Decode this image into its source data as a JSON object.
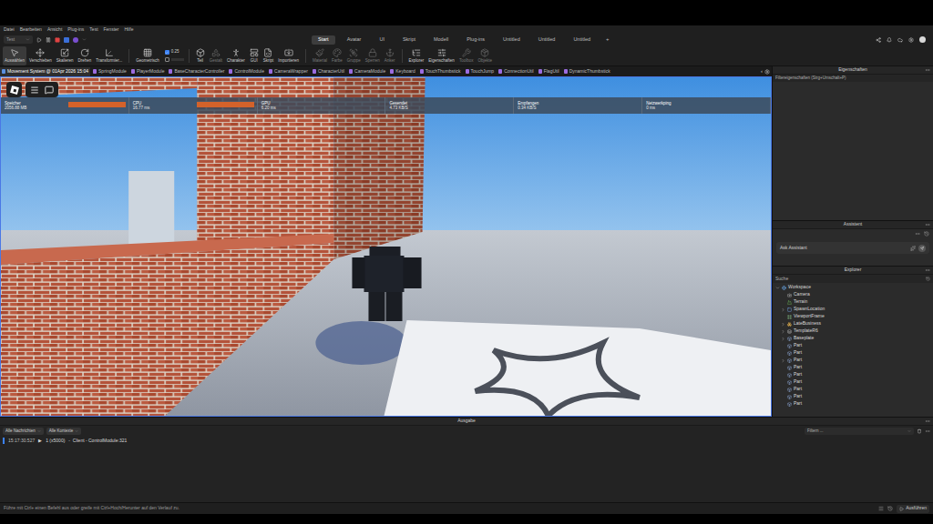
{
  "menu": [
    "Datei",
    "Bearbeiten",
    "Ansicht",
    "Plug-ins",
    "Test",
    "Fenster",
    "Hilfe"
  ],
  "mode_dropdown": "Test",
  "ribbon_tabs": [
    {
      "label": "Start",
      "selected": true
    },
    {
      "label": "Avatar",
      "selected": false
    },
    {
      "label": "UI",
      "selected": false
    },
    {
      "label": "Skript",
      "selected": false
    },
    {
      "label": "Modell",
      "selected": false
    },
    {
      "label": "Plug-ins",
      "selected": false
    },
    {
      "label": "Untitled",
      "selected": false
    },
    {
      "label": "Untitled",
      "selected": false
    },
    {
      "label": "Untitled",
      "selected": false
    }
  ],
  "ribbon_add": "+",
  "tool_groups": [
    [
      {
        "label": "Auswählen",
        "selected": true,
        "disabled": false
      },
      {
        "label": "Verschieben",
        "selected": false,
        "disabled": false
      },
      {
        "label": "Skalieren",
        "selected": false,
        "disabled": false
      },
      {
        "label": "Drehen",
        "selected": false,
        "disabled": false
      },
      {
        "label": "Transformier...",
        "selected": false,
        "disabled": false
      }
    ],
    [
      {
        "label": "Geometrisch",
        "selected": false,
        "disabled": false
      }
    ],
    [
      {
        "label": "Teil",
        "selected": false,
        "disabled": false
      },
      {
        "label": "Gestalt",
        "selected": false,
        "disabled": true
      },
      {
        "label": "Charakter",
        "selected": false,
        "disabled": false
      },
      {
        "label": "GUI",
        "selected": false,
        "disabled": false
      },
      {
        "label": "Skript",
        "selected": false,
        "disabled": false
      },
      {
        "label": "Importieren",
        "selected": false,
        "disabled": false
      }
    ],
    [
      {
        "label": "Material",
        "selected": false,
        "disabled": true
      },
      {
        "label": "Farbe",
        "selected": false,
        "disabled": true
      },
      {
        "label": "Gruppe",
        "selected": false,
        "disabled": true
      },
      {
        "label": "Sperren",
        "selected": false,
        "disabled": true
      },
      {
        "label": "Anker",
        "selected": false,
        "disabled": true
      }
    ],
    [
      {
        "label": "Explorer",
        "selected": false,
        "disabled": false
      },
      {
        "label": "Eigenschaften",
        "selected": false,
        "disabled": false
      },
      {
        "label": "Toolbox",
        "selected": false,
        "disabled": true
      },
      {
        "label": "Objekte",
        "selected": false,
        "disabled": true
      }
    ]
  ],
  "snap": {
    "value": "0.25",
    "checked": true
  },
  "doc_tabs": [
    {
      "label": "Movement System @ 01Apr 2026 15:04",
      "selected": true
    },
    {
      "label": "SpringModule",
      "selected": false
    },
    {
      "label": "PlayerModule",
      "selected": false
    },
    {
      "label": "BaseCharacterController",
      "selected": false
    },
    {
      "label": "ControlModule",
      "selected": false
    },
    {
      "label": "CameraWrapper",
      "selected": false
    },
    {
      "label": "CharacterUtil",
      "selected": false
    },
    {
      "label": "CameraModule",
      "selected": false
    },
    {
      "label": "Keyboard",
      "selected": false
    },
    {
      "label": "TouchThumbstick",
      "selected": false
    },
    {
      "label": "TouchJump",
      "selected": false
    },
    {
      "label": "ConnectionUtil",
      "selected": false
    },
    {
      "label": "FlagUtil",
      "selected": false
    },
    {
      "label": "DynamicThumbstick",
      "selected": false
    }
  ],
  "doc_tabs_overflow": "‹",
  "stats": [
    {
      "label": "Speicher",
      "value": "2056.88 MB",
      "alert": true
    },
    {
      "label": "CPU",
      "value": "16.77 ms",
      "alert": true
    },
    {
      "label": "GPU",
      "value": "6.20 ms",
      "alert": false
    },
    {
      "label": "Gesendet",
      "value": "4.73 KB/S",
      "alert": false
    },
    {
      "label": "Empfangen",
      "value": "0.34 KB/S",
      "alert": false
    },
    {
      "label": "Netzwerkping",
      "value": "0 ms",
      "alert": false
    }
  ],
  "properties": {
    "title": "Eigenschaften",
    "filter_placeholder": "Filtereigenschaften (Strg+Umschalt+P)"
  },
  "assistant": {
    "title": "Assistent",
    "placeholder": "Ask Assistant"
  },
  "explorer": {
    "title": "Explorer",
    "search_placeholder": "Suche",
    "items": [
      {
        "label": "Workspace",
        "depth": 0,
        "expandable": true,
        "expanded": true
      },
      {
        "label": "Camera",
        "depth": 1,
        "expandable": false,
        "expanded": false
      },
      {
        "label": "Terrain",
        "depth": 1,
        "expandable": false,
        "expanded": false
      },
      {
        "label": "SpawnLocation",
        "depth": 1,
        "expandable": true,
        "expanded": false
      },
      {
        "label": "ViewportFrame",
        "depth": 1,
        "expandable": false,
        "expanded": false
      },
      {
        "label": "LateBusiness",
        "depth": 1,
        "expandable": true,
        "expanded": false
      },
      {
        "label": "TemplateR6",
        "depth": 1,
        "expandable": true,
        "expanded": false
      },
      {
        "label": "Baseplate",
        "depth": 1,
        "expandable": true,
        "expanded": false
      },
      {
        "label": "Part",
        "depth": 1,
        "expandable": false,
        "expanded": false
      },
      {
        "label": "Part",
        "depth": 1,
        "expandable": false,
        "expanded": false
      },
      {
        "label": "Part",
        "depth": 1,
        "expandable": true,
        "expanded": false
      },
      {
        "label": "Part",
        "depth": 1,
        "expandable": false,
        "expanded": false
      },
      {
        "label": "Part",
        "depth": 1,
        "expandable": false,
        "expanded": false
      },
      {
        "label": "Part",
        "depth": 1,
        "expandable": false,
        "expanded": false
      },
      {
        "label": "Part",
        "depth": 1,
        "expandable": false,
        "expanded": false
      },
      {
        "label": "Part",
        "depth": 1,
        "expandable": false,
        "expanded": false
      },
      {
        "label": "Part",
        "depth": 1,
        "expandable": false,
        "expanded": false
      }
    ]
  },
  "output": {
    "title": "Ausgabe",
    "filters": [
      "Alle Nachrichten",
      "Alle Kontexte"
    ],
    "filter_placeholder": "Filtern ...",
    "lines": [
      {
        "time": "15:17:30.527",
        "toggle": "▶",
        "count": "1 (x5000)",
        "message": "-  Client - ControlModule:321"
      }
    ]
  },
  "command_bar": {
    "placeholder": "Führe mit Ctrl+ einen Befehl aus oder greife mit Ctrl+Hoch/Herunter auf den Verlauf zu.",
    "run_label": "Ausführen"
  }
}
